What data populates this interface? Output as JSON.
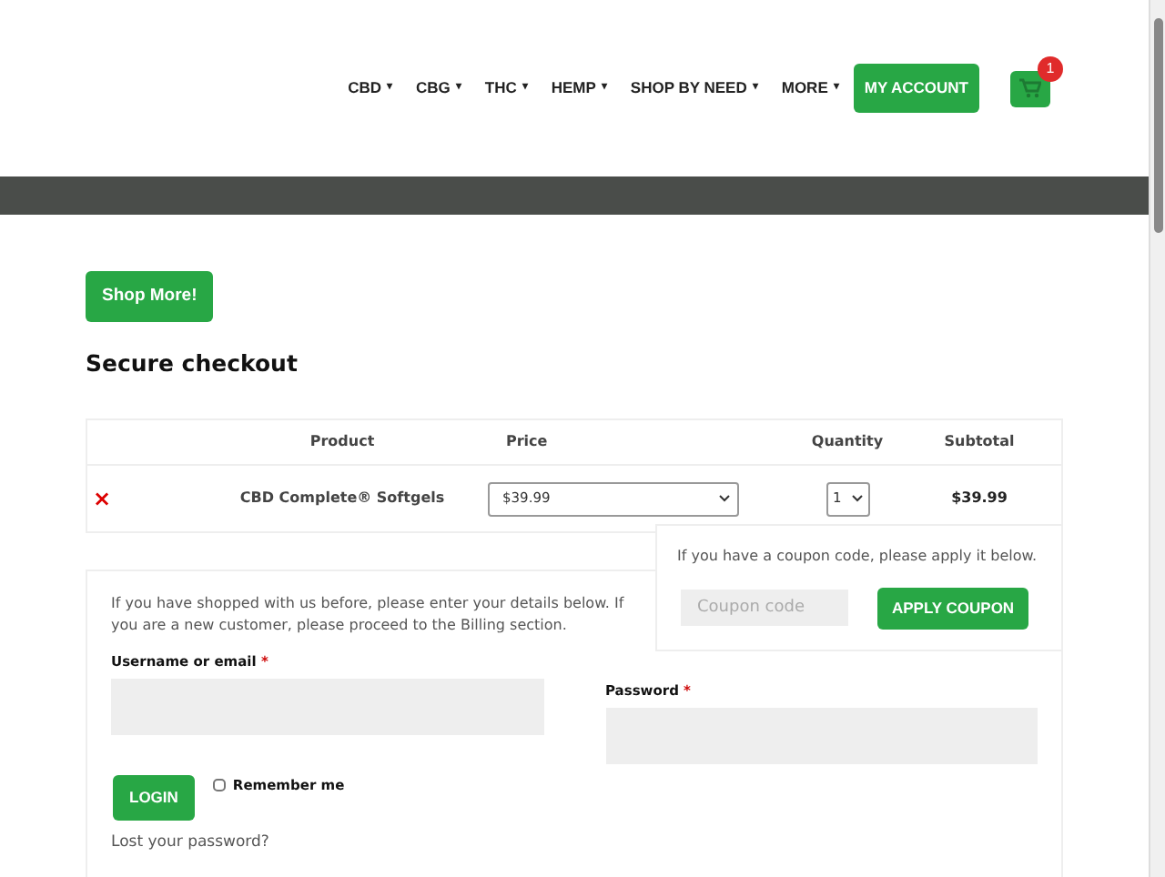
{
  "nav": {
    "items": [
      {
        "label": "CBD",
        "caret": "▾"
      },
      {
        "label": "CBG",
        "caret": "▾"
      },
      {
        "label": "THC",
        "caret": "▾"
      },
      {
        "label": "HEMP",
        "caret": "▾"
      },
      {
        "label": "SHOP BY NEED",
        "caret": "▾"
      },
      {
        "label": "MORE",
        "caret": "▾"
      }
    ],
    "account_button": "MY ACCOUNT",
    "cart_count": "1"
  },
  "shop_more_button": "Shop More!",
  "heading": "Secure checkout",
  "cart_table": {
    "columns": [
      "Product",
      "Price",
      "Quantity",
      "Subtotal"
    ],
    "rows": [
      {
        "remove": "×",
        "product": "CBD Complete® Softgels",
        "price": "$39.99",
        "quantity": "1",
        "subtotal": "$39.99"
      }
    ]
  },
  "coupon": {
    "text": "If you have a coupon code, please apply it below.",
    "placeholder": "Coupon code",
    "button": "APPLY COUPON"
  },
  "login": {
    "intro": "If you have shopped with us before, please enter your details below. If you are a new customer, please proceed to the Billing section.",
    "fields": [
      {
        "label": "Username or email",
        "required_mark": "*"
      },
      {
        "label": "Password",
        "required_mark": "*"
      }
    ],
    "button": "LOGIN",
    "remember": {
      "label": "Remember me",
      "checked": false
    },
    "lost_link": "Lost your password?"
  }
}
